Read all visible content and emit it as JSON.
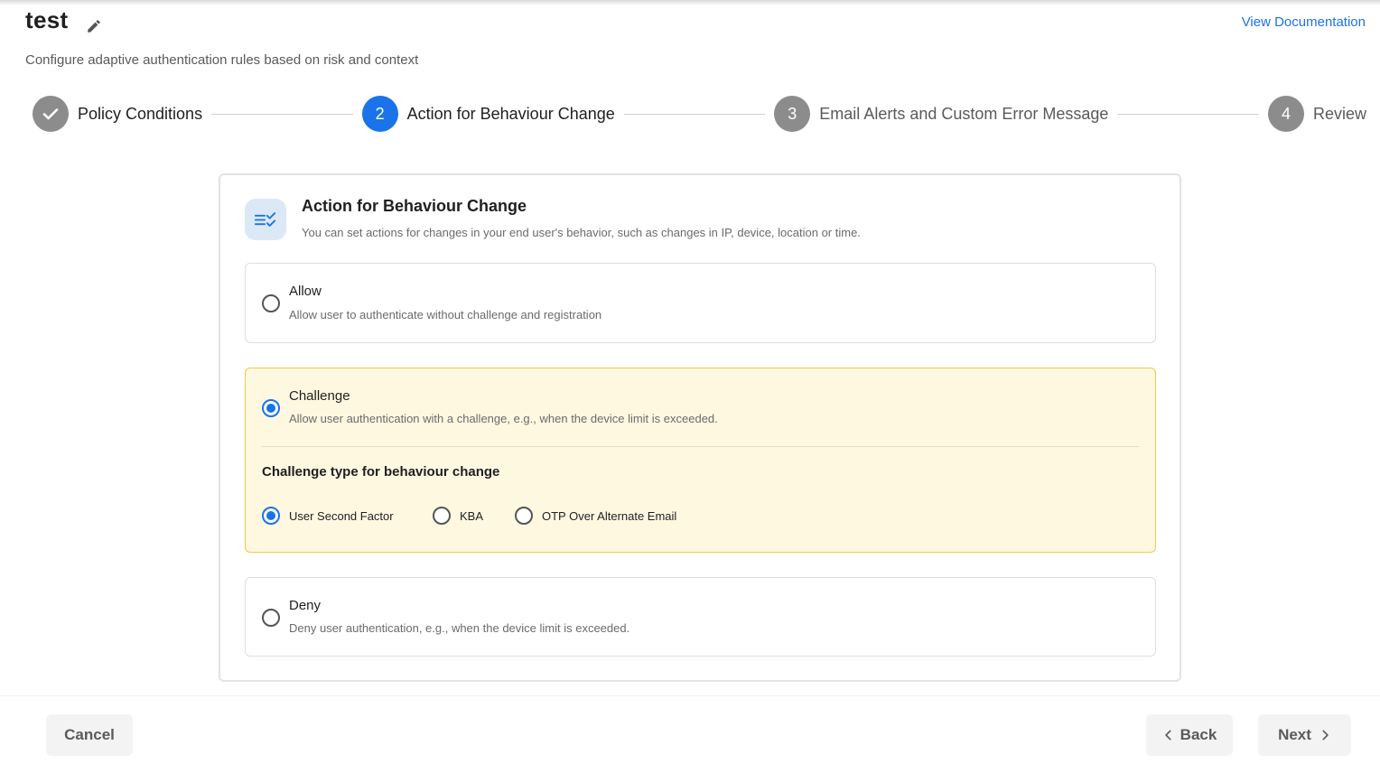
{
  "header": {
    "title": "test",
    "subtitle": "Configure adaptive authentication rules based on risk and context",
    "doc_link": "View Documentation"
  },
  "stepper": {
    "steps": [
      {
        "number": "1",
        "label": "Policy Conditions",
        "state": "completed"
      },
      {
        "number": "2",
        "label": "Action for Behaviour Change",
        "state": "active"
      },
      {
        "number": "3",
        "label": "Email Alerts and Custom Error Message",
        "state": "pending"
      },
      {
        "number": "4",
        "label": "Review",
        "state": "pending"
      }
    ]
  },
  "card": {
    "icon": "checklist-icon",
    "title": "Action for Behaviour Change",
    "description": "You can set actions for changes in your end user's behavior, such as changes in IP, device, location or time.",
    "options": {
      "allow": {
        "title": "Allow",
        "description": "Allow user to authenticate without challenge and registration",
        "selected": false
      },
      "challenge": {
        "title": "Challenge",
        "description": "Allow user authentication with a challenge, e.g., when the device limit is exceeded.",
        "selected": true
      },
      "deny": {
        "title": "Deny",
        "description": "Deny user authentication, e.g., when the device limit is exceeded.",
        "selected": false
      }
    },
    "challenge_type": {
      "title": "Challenge type for behaviour change",
      "options": [
        {
          "label": "User Second Factor",
          "selected": true
        },
        {
          "label": "KBA",
          "selected": false
        },
        {
          "label": "OTP Over Alternate Email",
          "selected": false
        }
      ]
    }
  },
  "footer": {
    "cancel_label": "Cancel",
    "back_label": "Back",
    "next_label": "Next"
  },
  "colors": {
    "accent": "#1a73e8",
    "selected_background": "#fff8e1",
    "selected_border": "#f1c84a",
    "inactive_step": "#8c8c8c"
  }
}
